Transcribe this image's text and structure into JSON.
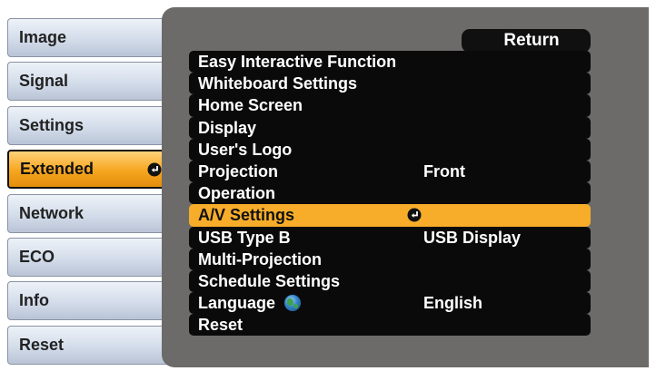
{
  "left_menu": {
    "items": [
      {
        "label": "Image"
      },
      {
        "label": "Signal"
      },
      {
        "label": "Settings"
      },
      {
        "label": "Extended",
        "selected": true,
        "icon": "enter-icon"
      },
      {
        "label": "Network"
      },
      {
        "label": "ECO"
      },
      {
        "label": "Info"
      },
      {
        "label": "Reset"
      }
    ]
  },
  "panel": {
    "return_label": "Return",
    "rows": [
      {
        "label": "Easy Interactive Function",
        "value": ""
      },
      {
        "label": "Whiteboard Settings",
        "value": ""
      },
      {
        "label": "Home Screen",
        "value": ""
      },
      {
        "label": "Display",
        "value": ""
      },
      {
        "label": "User's Logo",
        "value": ""
      },
      {
        "label": "Projection",
        "value": "Front"
      },
      {
        "label": "Operation",
        "value": ""
      },
      {
        "label": "A/V Settings",
        "value": "",
        "selected": true,
        "icon": "enter-icon"
      },
      {
        "label": "USB Type B",
        "value": "USB Display"
      },
      {
        "label": "Multi-Projection",
        "value": ""
      },
      {
        "label": "Schedule Settings",
        "value": ""
      },
      {
        "label": "Language",
        "value": "English",
        "icon": "globe-icon"
      },
      {
        "label": "Reset",
        "value": ""
      }
    ]
  },
  "colors": {
    "panel_bg": "#6c6b6a",
    "row_bg": "#0a0a0a",
    "highlight": "#f7ad2a",
    "tab_bg": "#d3dcea"
  }
}
